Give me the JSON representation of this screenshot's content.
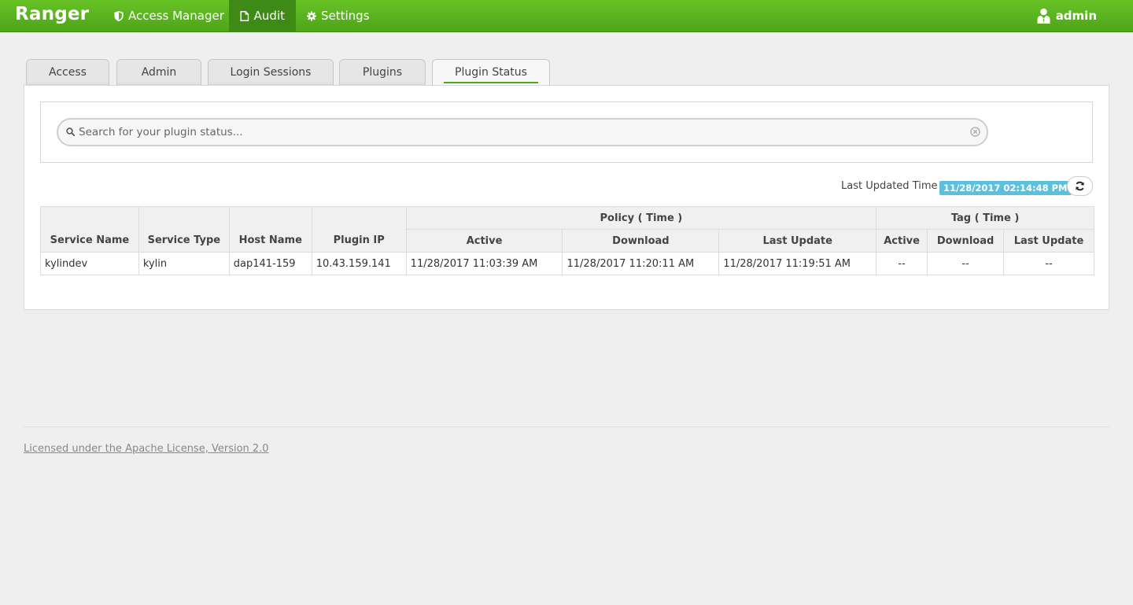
{
  "header": {
    "brand": "Ranger",
    "nav": [
      {
        "label": "Access Manager",
        "icon": "shield-icon"
      },
      {
        "label": "Audit",
        "icon": "file-icon"
      },
      {
        "label": "Settings",
        "icon": "gear-icon"
      }
    ],
    "user": "admin"
  },
  "tabs": [
    "Access",
    "Admin",
    "Login Sessions",
    "Plugins",
    "Plugin Status"
  ],
  "active_tab": "Plugin Status",
  "search": {
    "placeholder": "Search for your plugin status..."
  },
  "last_updated": {
    "label": "Last Updated Time :",
    "value": "11/28/2017 02:14:48 PM"
  },
  "table": {
    "headers": {
      "service_name": "Service Name",
      "service_type": "Service Type",
      "host_name": "Host Name",
      "plugin_ip": "Plugin IP",
      "policy_group": "Policy ( Time )",
      "tag_group": "Tag ( Time )",
      "active": "Active",
      "download": "Download",
      "last_update": "Last Update"
    },
    "rows": [
      {
        "service_name": "kylindev",
        "service_type": "kylin",
        "host_name": "dap141-159",
        "plugin_ip": "10.43.159.141",
        "policy_active": "11/28/2017 11:03:39 AM",
        "policy_download": "11/28/2017 11:20:11 AM",
        "policy_last_update": "11/28/2017 11:19:51 AM",
        "tag_active": "--",
        "tag_download": "--",
        "tag_last_update": "--"
      }
    ]
  },
  "footer": {
    "license": "Licensed under the Apache License, Version 2.0"
  },
  "colors": {
    "nav_green": "#5cb520",
    "badge_blue": "#5bc0de"
  }
}
